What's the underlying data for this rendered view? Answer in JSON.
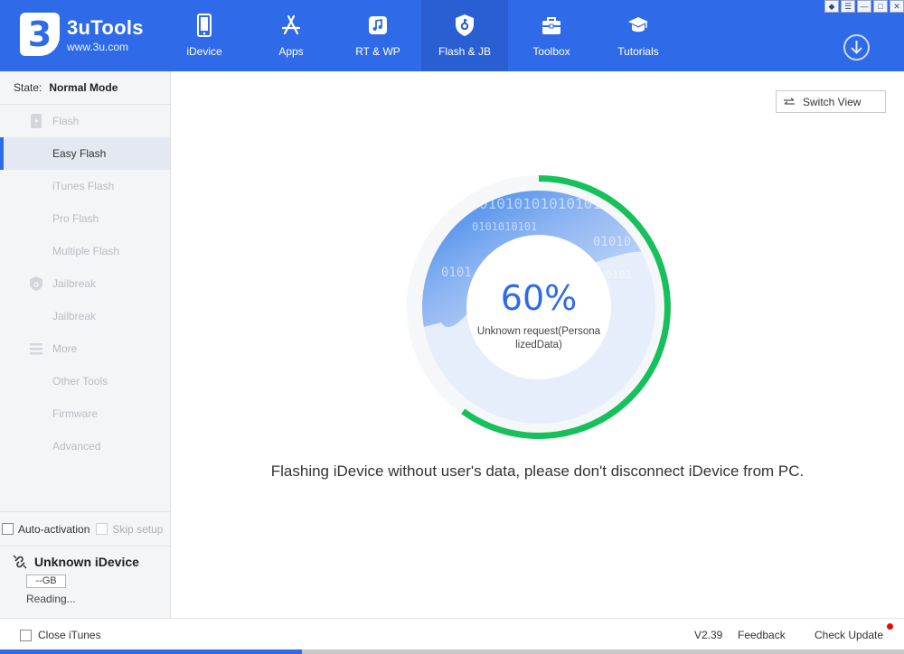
{
  "app": {
    "name": "3uTools",
    "url": "www.3u.com",
    "logo_glyph": "3",
    "brand_color": "#2f6be8"
  },
  "nav": {
    "items": [
      {
        "label": "iDevice",
        "icon": "phone-icon"
      },
      {
        "label": "Apps",
        "icon": "app-store-icon"
      },
      {
        "label": "RT & WP",
        "icon": "music-note-icon"
      },
      {
        "label": "Flash & JB",
        "icon": "shield-key-icon"
      },
      {
        "label": "Toolbox",
        "icon": "toolbox-icon"
      },
      {
        "label": "Tutorials",
        "icon": "graduation-cap-icon"
      }
    ],
    "active": "Flash & JB"
  },
  "window_controls": [
    "shirt-icon",
    "menu-icon",
    "minimize-icon",
    "maximize-icon",
    "close-icon"
  ],
  "sidebar": {
    "state_label": "State:",
    "state_value": "Normal Mode",
    "menu": [
      {
        "label": "Flash",
        "type": "section",
        "icon": "flash-device-icon"
      },
      {
        "label": "Easy Flash",
        "type": "item",
        "selected": true
      },
      {
        "label": "iTunes Flash",
        "type": "item"
      },
      {
        "label": "Pro Flash",
        "type": "item"
      },
      {
        "label": "Multiple Flash",
        "type": "item"
      },
      {
        "label": "Jailbreak",
        "type": "section",
        "icon": "shield-icon"
      },
      {
        "label": "Jailbreak",
        "type": "item"
      },
      {
        "label": "More",
        "type": "section",
        "icon": "list-icon"
      },
      {
        "label": "Other Tools",
        "type": "item"
      },
      {
        "label": "Firmware",
        "type": "item"
      },
      {
        "label": "Advanced",
        "type": "item"
      }
    ],
    "auto_activation_label": "Auto-activation",
    "skip_setup_label": "Skip setup",
    "device": {
      "name": "Unknown iDevice",
      "capacity": "--GB",
      "status": "Reading...",
      "icon": "disconnected-link-icon"
    }
  },
  "main": {
    "switch_view_label": "Switch View",
    "progress": {
      "percent": 60,
      "percent_text": "60%",
      "status_line1": "Unknown request(Persona",
      "status_line2": "lizedData)",
      "binary_text": [
        "01010101010101",
        "0101010101",
        "01010",
        "0101",
        "0101"
      ],
      "ring_color": "#16c05a"
    },
    "message": "Flashing iDevice without user's data, please don't disconnect iDevice from PC."
  },
  "footer": {
    "close_itunes_label": "Close iTunes",
    "version": "V2.39",
    "feedback_label": "Feedback",
    "check_update_label": "Check Update"
  }
}
